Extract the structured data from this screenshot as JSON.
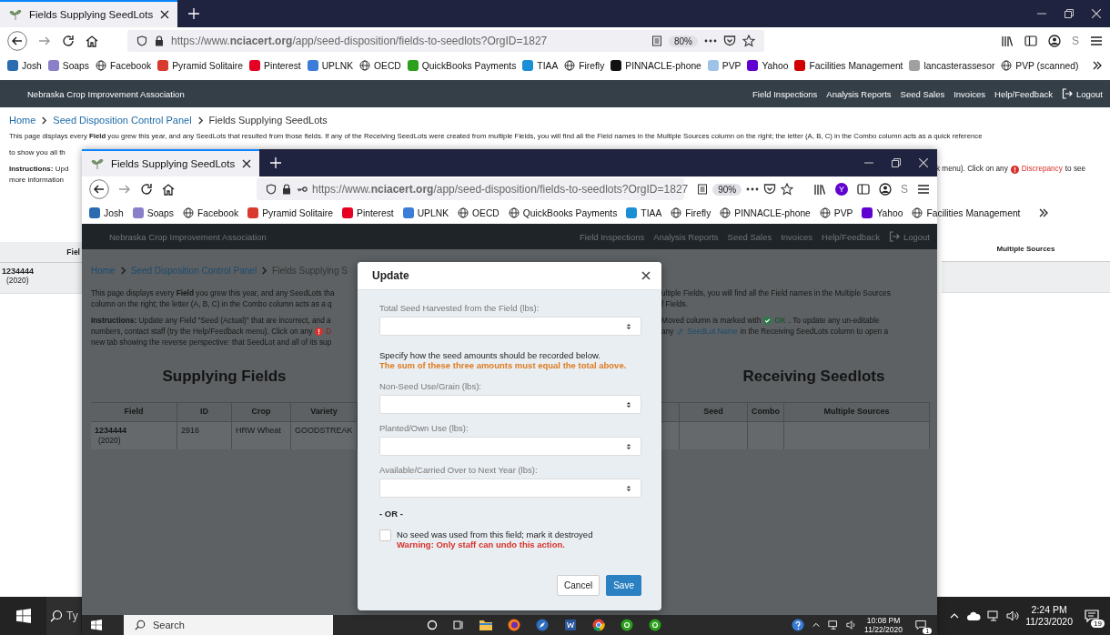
{
  "outer": {
    "tab_title": "Fields Supplying SeedLots",
    "url": "https://www.**nciacert.org**/app/seed-disposition/fields-to-seedlots?OrgID=1827",
    "saved_password": false,
    "zoom": "80%",
    "profile_letter": "S",
    "bookmarks": [
      {
        "label": "Josh",
        "kind": "favicon",
        "color": "#2b6cb0"
      },
      {
        "label": "Soaps",
        "kind": "favicon",
        "color": "#8a7fc9"
      },
      {
        "label": "Facebook",
        "kind": "globe"
      },
      {
        "label": "Pyramid Solitaire",
        "kind": "favicon",
        "color": "#d83a2e"
      },
      {
        "label": "Pinterest",
        "kind": "favicon",
        "color": "#e60023"
      },
      {
        "label": "UPLNK",
        "kind": "favicon",
        "color": "#3b7dd8"
      },
      {
        "label": "OECD",
        "kind": "globe"
      },
      {
        "label": "QuickBooks Payments",
        "kind": "favicon",
        "color": "#2ca01c"
      },
      {
        "label": "TIAA",
        "kind": "favicon",
        "color": "#1a8fd6"
      },
      {
        "label": "Firefly",
        "kind": "globe"
      },
      {
        "label": "PINNACLE-phone",
        "kind": "favicon",
        "color": "#111111"
      },
      {
        "label": "PVP",
        "kind": "favicon",
        "color": "#9ec3e6"
      },
      {
        "label": "Yahoo",
        "kind": "favicon",
        "color": "#6001d2"
      },
      {
        "label": "Facilities Management",
        "kind": "favicon",
        "color": "#d00000"
      },
      {
        "label": "lancasterassesor",
        "kind": "favicon",
        "color": "#a0a0a0"
      },
      {
        "label": "PVP (scanned)",
        "kind": "globe"
      }
    ],
    "site_name": "Nebraska Crop Improvement Association",
    "menu": [
      "Field Inspections",
      "Analysis Reports",
      "Seed Sales",
      "Invoices",
      "Help/Feedback"
    ],
    "logout": "Logout",
    "page": {
      "breadcrumb": [
        {
          "label": "Home",
          "link": true
        },
        {
          "label": "Seed Disposition Control Panel",
          "link": true
        },
        {
          "label": "Fields Supplying SeedLots",
          "link": false
        }
      ],
      "intro": "This page displays every **Field** you grew this year, and any SeedLots that resulted from those fields. If any of the Receiving SeedLots were created from multiple Fields, you will find all the Field names in the Multiple Sources column on the right; the letter (A, B, C) in the Combo column acts as a quick reference",
      "intro_cut": "to show you all th",
      "instructions_cut": "**Instructions:** Upd",
      "instructions_tail": "k menu). Click on any",
      "discrepancy_link": "Discrepancy",
      "instructions_end": "to see",
      "more_info": "more information",
      "left_header": "Fiel",
      "field": "1234444",
      "year": "(2020)",
      "right_header": "Multiple Sources"
    },
    "taskbar": {
      "search_placeholder": "Ty",
      "time": "2:24 PM",
      "date": "11/23/2020",
      "notifications": "19"
    }
  },
  "inner": {
    "tab_title": "Fields Supplying SeedLots",
    "url": "https://www.**nciacert.org**/app/seed-disposition/fields-to-seedlots?OrgID=1827",
    "saved_password": true,
    "zoom": "90%",
    "extension": "Y",
    "profile_letter": "S",
    "bookmarks": [
      {
        "label": "Josh",
        "kind": "favicon",
        "color": "#2b6cb0"
      },
      {
        "label": "Soaps",
        "kind": "favicon",
        "color": "#8a7fc9"
      },
      {
        "label": "Facebook",
        "kind": "globe"
      },
      {
        "label": "Pyramid Solitaire",
        "kind": "favicon",
        "color": "#d83a2e"
      },
      {
        "label": "Pinterest",
        "kind": "favicon",
        "color": "#e60023"
      },
      {
        "label": "UPLNK",
        "kind": "favicon",
        "color": "#3b7dd8"
      },
      {
        "label": "OECD",
        "kind": "globe"
      },
      {
        "label": "QuickBooks Payments",
        "kind": "globe"
      },
      {
        "label": "TIAA",
        "kind": "favicon",
        "color": "#1a8fd6"
      },
      {
        "label": "Firefly",
        "kind": "globe"
      },
      {
        "label": "PINNACLE-phone",
        "kind": "globe"
      },
      {
        "label": "PVP",
        "kind": "globe"
      },
      {
        "label": "Yahoo",
        "kind": "favicon",
        "color": "#6001d2"
      },
      {
        "label": "Facilities Management",
        "kind": "globe"
      }
    ],
    "site_name": "Nebraska Crop Improvement Association",
    "menu": [
      "Field Inspections",
      "Analysis Reports",
      "Seed Sales",
      "Invoices",
      "Help/Feedback"
    ],
    "logout": "Logout",
    "page": {
      "breadcrumb": [
        {
          "label": "Home",
          "link": true
        },
        {
          "label": "Seed Disposition Control Panel",
          "link": true
        },
        {
          "label": "Fields Supplying S",
          "link": false
        }
      ],
      "left_lines": [
        "This page displays every **Field** you grew this year, and any SeedLots tha",
        "column on the right; the letter (A, B, C) in the Combo column acts as a q"
      ],
      "instructions_first": "**Instructions:** Update any Field \"Seed (Actual)\" that are incorrect, and a",
      "instructions_second": "numbers, contact staff (try the Help/Feedback menu). Click on any",
      "discrepancy_cut": "D",
      "instructions_third": "new tab showing the reverse perspective: that SeedLot and all of its sup",
      "right_lines": [
        "ultiple Fields, you will find all the Field names in the Multiple Sources",
        "f Fields."
      ],
      "moved_before": "Moved column is marked with",
      "ok_label": "OK",
      "moved_after": ". To update any un-editable",
      "seedlot_before": "any",
      "seedlot_link": "SeedLot Name",
      "seedlot_after": "in the Receiving SeedLots column to open a",
      "left_heading": "Supplying Fields",
      "right_heading": "Receiving Seedlots",
      "left_columns": [
        "Field",
        "ID",
        "Crop",
        "Variety"
      ],
      "left_row": {
        "field": "1234444",
        "year": "(2020)",
        "cells": [
          "2916",
          "HRW Wheat",
          "GOODSTREAK"
        ]
      },
      "right_columns": [
        "Seed",
        "Combo",
        "Multiple Sources"
      ]
    },
    "modal": {
      "title": "Update",
      "total_label": "Total Seed Harvested from the Field (lbs):",
      "note": "Specify how the seed amounts should be recorded below.",
      "sum_note": "The sum of these three amounts must equal the total above.",
      "split_labels": [
        "Non-Seed Use/Grain (lbs):",
        "Planted/Own Use (lbs):",
        "Available/Carried Over to Next Year (lbs):"
      ],
      "or": "- OR -",
      "destroy": {
        "label": "No seed was used from this field; mark it destroyed",
        "checked": false
      },
      "warning": "Warning: Only staff can undo this action.",
      "buttons": [
        {
          "label": "Cancel",
          "kind": "secondary"
        },
        {
          "label": "Save",
          "kind": "primary"
        }
      ]
    },
    "taskbar": {
      "search_placeholder": "Search",
      "apps": [
        {
          "kind": "cortana"
        },
        {
          "kind": "taskview"
        },
        {
          "kind": "folder"
        },
        {
          "kind": "firefox"
        },
        {
          "kind": "compass"
        },
        {
          "kind": "word"
        },
        {
          "kind": "chrome"
        },
        {
          "kind": "quickbooks"
        },
        {
          "kind": "quickbooks"
        }
      ],
      "time": "10:08 PM",
      "date": "11/22/2020",
      "notifications": "1"
    }
  }
}
